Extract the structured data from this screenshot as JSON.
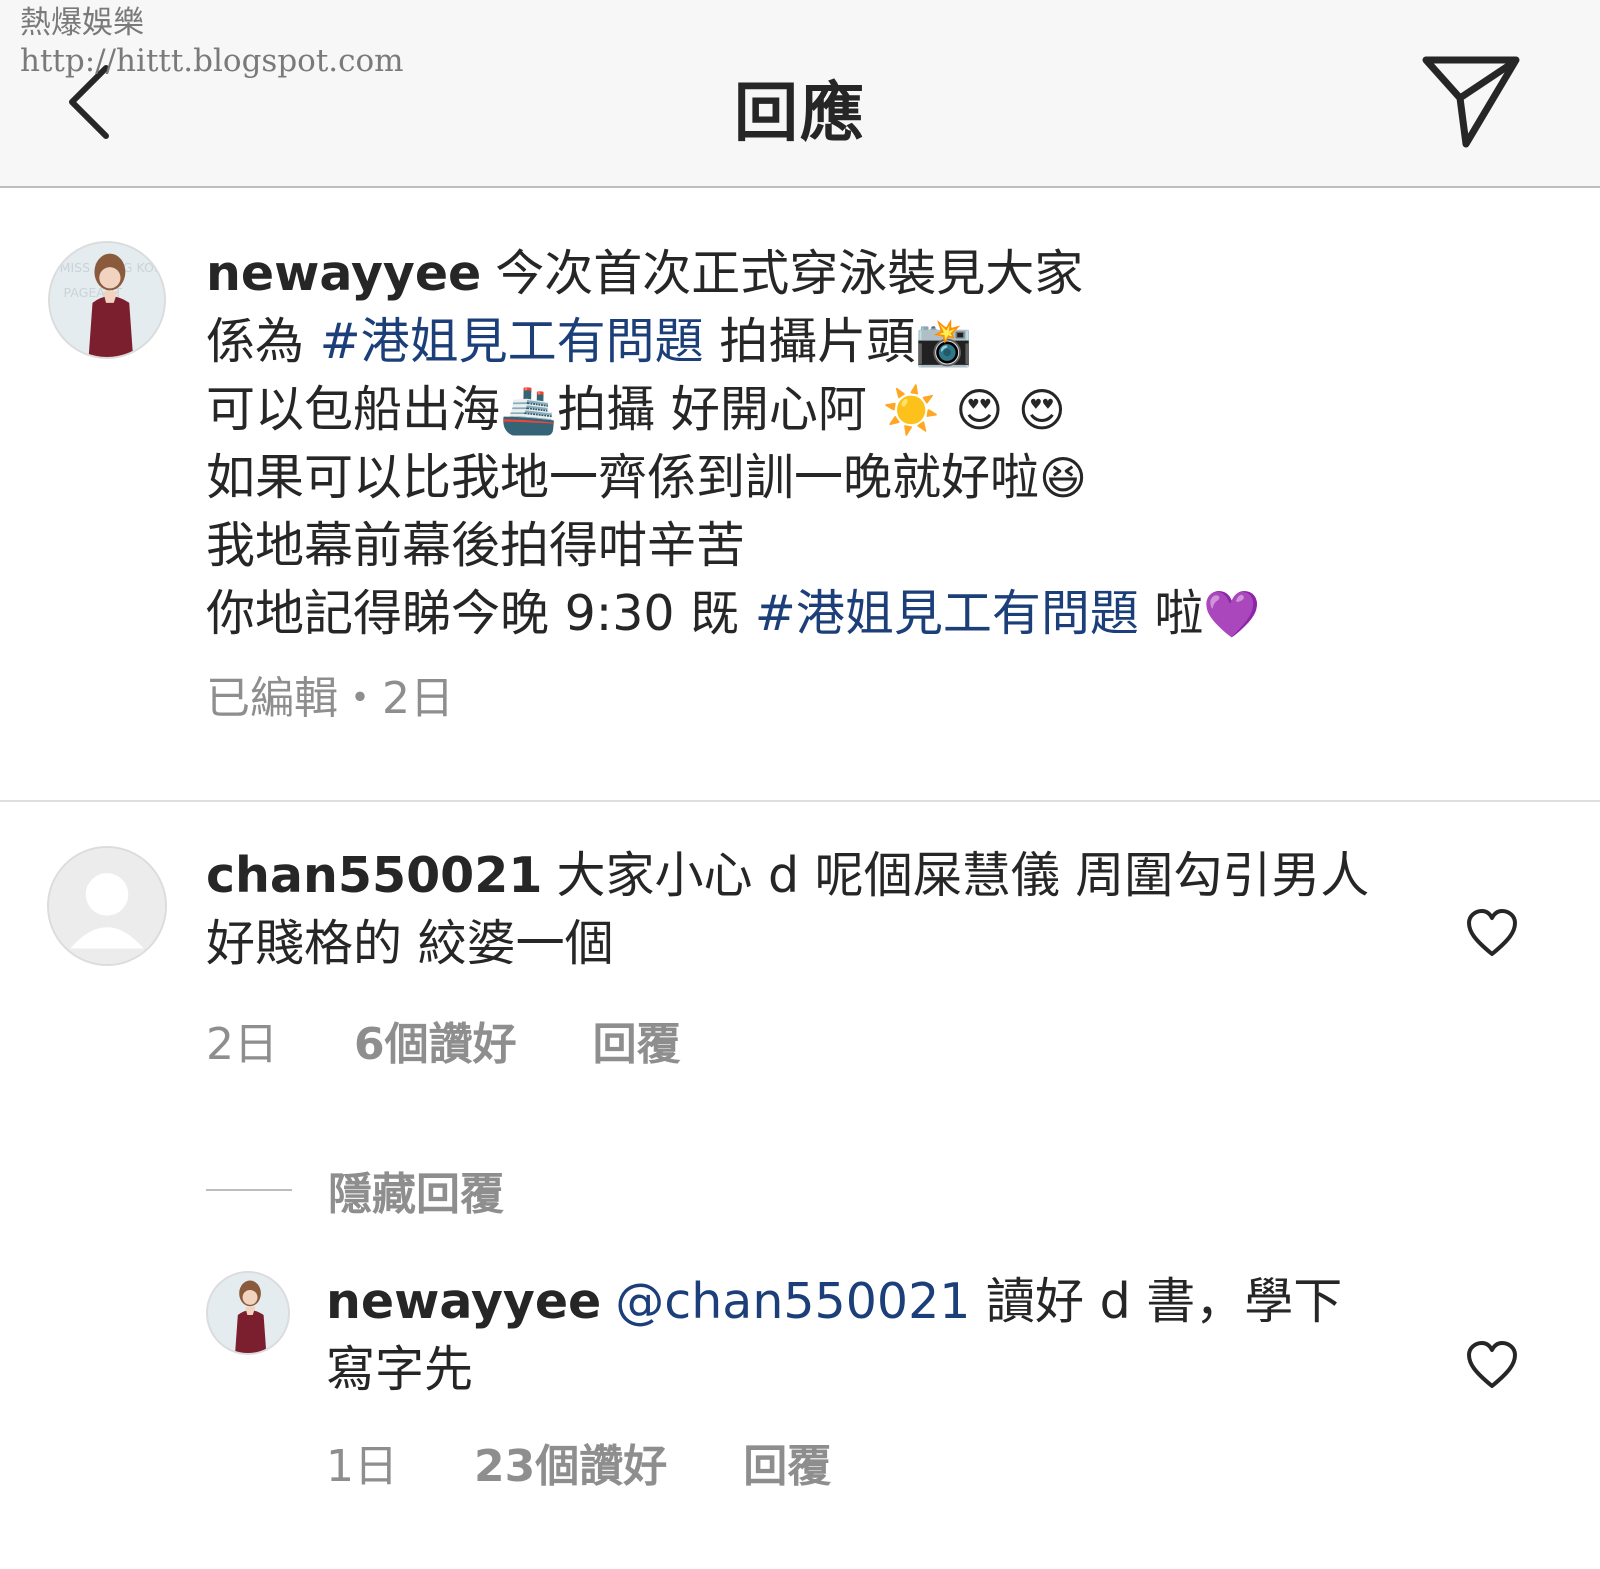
{
  "watermark": {
    "line1": "熱爆娛樂",
    "line2": "http://hittt.blogspot.com"
  },
  "header": {
    "title": "回應",
    "back_icon": "chevron-left-icon",
    "send_icon": "paper-plane-icon"
  },
  "caption": {
    "username": "newayyee",
    "line1": "今次首次正式穿泳裝見大家",
    "line2_a": "係為 ",
    "hashtag": "#港姐見工有問題",
    "line2_b": " 拍攝片頭",
    "emoji_camera": "📸",
    "line3_a": "可以包船出海",
    "emoji_ship": "🚢",
    "line3_b": "拍攝 好開心阿 ",
    "emoji_sun": "☀️",
    "emoji_hearteyes": "😍 😍",
    "line4": "如果可以比我地一齊係到訓一晚就好啦",
    "emoji_laugh": "😆",
    "line5": "我地幕前幕後拍得咁辛苦",
    "line6_a": "你地記得睇今晚 9:30 既 ",
    "hashtag2": "#港姐見工有問題",
    "line6_b": " 啦",
    "emoji_heart": "💜",
    "edited": "已編輯・2日"
  },
  "comments": [
    {
      "username": "chan550021",
      "text": "大家小心 d 呢個屎慧儀 周圍勾引男人 好賤格的 絞婆一個",
      "time": "2日",
      "likes": "6個讚好",
      "reply": "回覆"
    }
  ],
  "hide_replies": "隱藏回覆",
  "replies": [
    {
      "username": "newayyee",
      "mention": "@chan550021",
      "text": " 讀好 d 書，學下寫字先",
      "time": "1日",
      "likes": "23個讚好",
      "reply": "回覆"
    }
  ]
}
